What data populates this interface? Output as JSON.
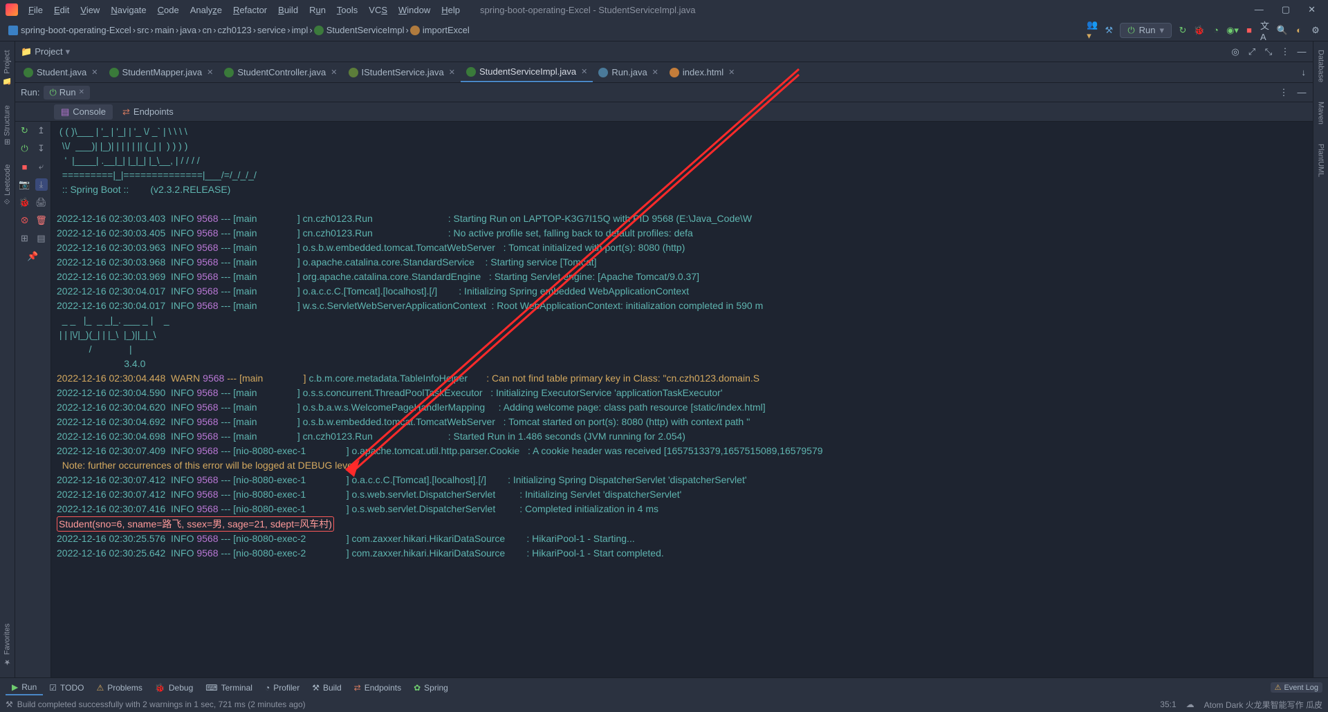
{
  "menu": {
    "items": [
      "File",
      "Edit",
      "View",
      "Navigate",
      "Code",
      "Analyze",
      "Refactor",
      "Build",
      "Run",
      "Tools",
      "VCS",
      "Window",
      "Help"
    ],
    "title": "spring-boot-operating-Excel - StudentServiceImpl.java"
  },
  "winctl": {
    "min": "—",
    "max": "▢",
    "close": "✕"
  },
  "breadcrumbs": [
    {
      "icon": "folder",
      "label": "spring-boot-operating-Excel"
    },
    {
      "label": "src"
    },
    {
      "label": "main"
    },
    {
      "label": "java"
    },
    {
      "label": "cn"
    },
    {
      "label": "czh0123"
    },
    {
      "label": "service"
    },
    {
      "label": "impl"
    },
    {
      "icon": "class",
      "label": "StudentServiceImpl"
    },
    {
      "icon": "method",
      "label": "importExcel"
    }
  ],
  "runcfg": {
    "label": "Run"
  },
  "project": {
    "label": "Project"
  },
  "ltabs": [
    "Project",
    "Structure",
    "Leetcode",
    "Favorites"
  ],
  "rtabs": [
    "Database",
    "Maven",
    "PlantUML"
  ],
  "editorTabs": [
    {
      "label": "Student.java",
      "icon": "j",
      "closable": true
    },
    {
      "label": "StudentMapper.java",
      "icon": "j",
      "closable": true
    },
    {
      "label": "StudentController.java",
      "icon": "j",
      "closable": true
    },
    {
      "label": "IStudentService.java",
      "icon": "i",
      "closable": true
    },
    {
      "label": "StudentServiceImpl.java",
      "icon": "j",
      "closable": true,
      "active": true
    },
    {
      "label": "Run.java",
      "icon": "r",
      "closable": true
    },
    {
      "label": "index.html",
      "icon": "h",
      "closable": true
    }
  ],
  "runPanel": {
    "title": "Run:",
    "tab": "Run"
  },
  "consoleTabs": [
    {
      "label": "Console",
      "active": true
    },
    {
      "label": "Endpoints"
    }
  ],
  "ascii": [
    " ( ( )\\___ | '_ | '_| | '_ \\/ _` | \\ \\ \\ \\",
    "  \\\\/  ___)| |_)| | | | | || (_| |  ) ) ) )",
    "   '  |____| .__|_| |_|_| |_\\__, | / / / /",
    "  =========|_|==============|___/=/_/_/_/",
    "  :: Spring Boot ::        (v2.3.2.RELEASE)",
    ""
  ],
  "mpAscii": [
    "  _ _   |_  _ _|_. ___ _ |    _",
    " | | |\\/|_)(_| | |_\\  |_)||_|_\\",
    "            /              |",
    "                         3.4.0"
  ],
  "logs": [
    {
      "ts": "2022-12-16 02:30:03.403",
      "lvl": "INFO",
      "pid": "9568",
      "thread": "main",
      "logger": "cn.czh0123.Run",
      "msg": "Starting Run on LAPTOP-K3G7I15Q with PID 9568 (E:\\Java_Code\\W"
    },
    {
      "ts": "2022-12-16 02:30:03.405",
      "lvl": "INFO",
      "pid": "9568",
      "thread": "main",
      "logger": "cn.czh0123.Run",
      "msg": "No active profile set, falling back to default profiles: defa"
    },
    {
      "ts": "2022-12-16 02:30:03.963",
      "lvl": "INFO",
      "pid": "9568",
      "thread": "main",
      "logger": "o.s.b.w.embedded.tomcat.TomcatWebServer",
      "msg": "Tomcat initialized with port(s): 8080 (http)"
    },
    {
      "ts": "2022-12-16 02:30:03.968",
      "lvl": "INFO",
      "pid": "9568",
      "thread": "main",
      "logger": "o.apache.catalina.core.StandardService",
      "msg": "Starting service [Tomcat]"
    },
    {
      "ts": "2022-12-16 02:30:03.969",
      "lvl": "INFO",
      "pid": "9568",
      "thread": "main",
      "logger": "org.apache.catalina.core.StandardEngine",
      "msg": "Starting Servlet engine: [Apache Tomcat/9.0.37]"
    },
    {
      "ts": "2022-12-16 02:30:04.017",
      "lvl": "INFO",
      "pid": "9568",
      "thread": "main",
      "logger": "o.a.c.c.C.[Tomcat].[localhost].[/]",
      "msg": "Initializing Spring embedded WebApplicationContext"
    },
    {
      "ts": "2022-12-16 02:30:04.017",
      "lvl": "INFO",
      "pid": "9568",
      "thread": "main",
      "logger": "w.s.c.ServletWebServerApplicationContext",
      "msg": "Root WebApplicationContext: initialization completed in 590 m"
    }
  ],
  "logs2": [
    {
      "ts": "2022-12-16 02:30:04.448",
      "lvl": "WARN",
      "pid": "9568",
      "thread": "main",
      "logger": "c.b.m.core.metadata.TableInfoHelper",
      "msg": "Can not find table primary key in Class: \"cn.czh0123.domain.S"
    },
    {
      "ts": "2022-12-16 02:30:04.590",
      "lvl": "INFO",
      "pid": "9568",
      "thread": "main",
      "logger": "o.s.s.concurrent.ThreadPoolTaskExecutor",
      "msg": "Initializing ExecutorService 'applicationTaskExecutor'"
    },
    {
      "ts": "2022-12-16 02:30:04.620",
      "lvl": "INFO",
      "pid": "9568",
      "thread": "main",
      "logger": "o.s.b.a.w.s.WelcomePageHandlerMapping",
      "msg": "Adding welcome page: class path resource [static/index.html]"
    },
    {
      "ts": "2022-12-16 02:30:04.692",
      "lvl": "INFO",
      "pid": "9568",
      "thread": "main",
      "logger": "o.s.b.w.embedded.tomcat.TomcatWebServer",
      "msg": "Tomcat started on port(s): 8080 (http) with context path ''"
    },
    {
      "ts": "2022-12-16 02:30:04.698",
      "lvl": "INFO",
      "pid": "9568",
      "thread": "main",
      "logger": "cn.czh0123.Run",
      "msg": "Started Run in 1.486 seconds (JVM running for 2.054)"
    },
    {
      "ts": "2022-12-16 02:30:07.409",
      "lvl": "INFO",
      "pid": "9568",
      "thread": "nio-8080-exec-1",
      "logger": "o.apache.tomcat.util.http.parser.Cookie",
      "msg": "A cookie header was received [1657513379,1657515089,16579579"
    }
  ],
  "note": "  Note: further occurrences of this error will be logged at DEBUG level.",
  "logs3": [
    {
      "ts": "2022-12-16 02:30:07.412",
      "lvl": "INFO",
      "pid": "9568",
      "thread": "nio-8080-exec-1",
      "logger": "o.a.c.c.C.[Tomcat].[localhost].[/]",
      "msg": "Initializing Spring DispatcherServlet 'dispatcherServlet'"
    },
    {
      "ts": "2022-12-16 02:30:07.412",
      "lvl": "INFO",
      "pid": "9568",
      "thread": "nio-8080-exec-1",
      "logger": "o.s.web.servlet.DispatcherServlet",
      "msg": "Initializing Servlet 'dispatcherServlet'"
    },
    {
      "ts": "2022-12-16 02:30:07.416",
      "lvl": "INFO",
      "pid": "9568",
      "thread": "nio-8080-exec-1",
      "logger": "o.s.web.servlet.DispatcherServlet",
      "msg": "Completed initialization in 4 ms"
    }
  ],
  "highlight": "Student(sno=6, sname=路飞, ssex=男, sage=21, sdept=风车村)",
  "logs4": [
    {
      "ts": "2022-12-16 02:30:25.576",
      "lvl": "INFO",
      "pid": "9568",
      "thread": "nio-8080-exec-2",
      "logger": "com.zaxxer.hikari.HikariDataSource",
      "msg": "HikariPool-1 - Starting..."
    },
    {
      "ts": "2022-12-16 02:30:25.642",
      "lvl": "INFO",
      "pid": "9568",
      "thread": "nio-8080-exec-2",
      "logger": "com.zaxxer.hikari.HikariDataSource",
      "msg": "HikariPool-1 - Start completed."
    }
  ],
  "bottom": [
    {
      "label": "Run",
      "icon": "tri",
      "active": true
    },
    {
      "label": "TODO",
      "icon": "todo"
    },
    {
      "label": "Problems",
      "icon": "prob"
    },
    {
      "label": "Debug",
      "icon": "bug"
    },
    {
      "label": "Terminal",
      "icon": "term"
    },
    {
      "label": "Profiler",
      "icon": "prof"
    },
    {
      "label": "Build",
      "icon": "build"
    },
    {
      "label": "Endpoints",
      "icon": "ep"
    },
    {
      "label": "Spring",
      "icon": "spring"
    }
  ],
  "eventlog": "Event Log",
  "status": {
    "msg": "Build completed successfully with 2 warnings in 1 sec, 721 ms (2 minutes ago)",
    "pos": "35:1",
    "enc": "Atom Dark 火龙果智能写作 瓜皮"
  }
}
